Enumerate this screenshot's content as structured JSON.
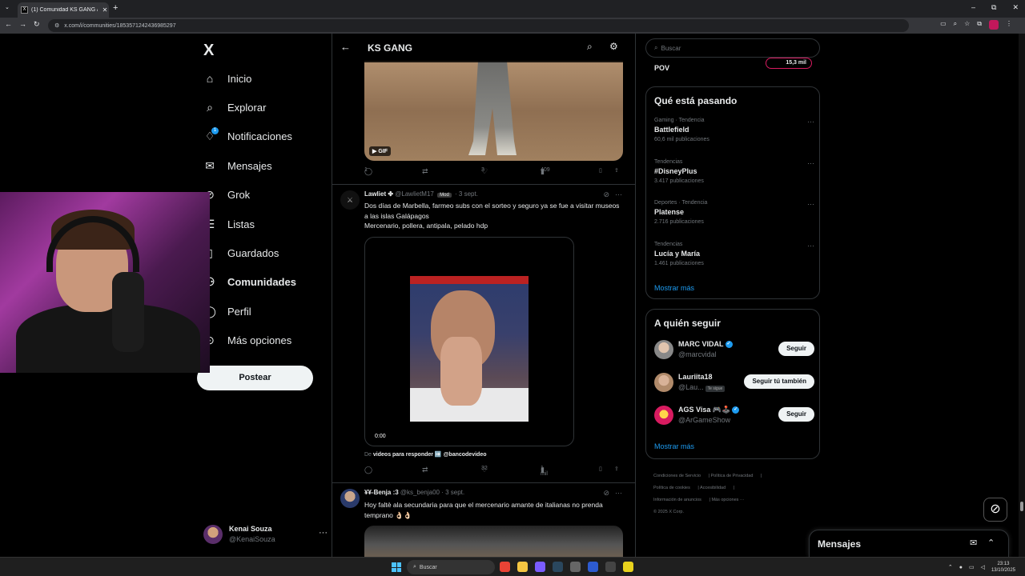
{
  "browser": {
    "tab_title": "(1) Comunidad KS GANG / X",
    "tab_favicon": "X",
    "url": "x.com/i/communities/1853571242436985297"
  },
  "nav": {
    "logo": "X",
    "items": [
      {
        "label": "Inicio",
        "icon": "home-icon",
        "glyph": "⌂"
      },
      {
        "label": "Explorar",
        "icon": "search-icon",
        "glyph": "⌕"
      },
      {
        "label": "Notificaciones",
        "icon": "bell-icon",
        "glyph": "♢",
        "badge": "1"
      },
      {
        "label": "Mensajes",
        "icon": "mail-icon",
        "glyph": "✉"
      },
      {
        "label": "Grok",
        "icon": "grok-icon",
        "glyph": "⊘"
      },
      {
        "label": "Listas",
        "icon": "list-icon",
        "glyph": "☰"
      },
      {
        "label": "Guardados",
        "icon": "bookmark-icon",
        "glyph": "▯"
      },
      {
        "label": "Comunidades",
        "icon": "communities-icon",
        "glyph": "⚇",
        "active": true
      },
      {
        "label": "Perfil",
        "icon": "profile-icon",
        "glyph": "◯"
      },
      {
        "label": "Más opciones",
        "icon": "more-circle-icon",
        "glyph": "⊙"
      }
    ],
    "post_button": "Postear",
    "account": {
      "name": "Kenai Souza",
      "handle": "@KenaiSouza",
      "more": "···"
    }
  },
  "header": {
    "title": "KS GANG",
    "back": "←"
  },
  "tweet0": {
    "gif_label": "GIF",
    "replies": "1",
    "retweets": "",
    "likes": "3",
    "views": "409"
  },
  "tweet1": {
    "name": "Lawliet ✤",
    "handle": "@LawlietM17",
    "role": "Mod",
    "time": "· 3 sept.",
    "text1": "Dos días de Marbella, farmeo subs con el sorteo y seguro ya se fue a visitar museos a las islas Galápagos",
    "text2": "Mercenario, pollera, antipala, pelado hdp",
    "video_time": "0:00",
    "source_prefix": "De",
    "source_bold": "videos para responder ➡️ @bancodevideo",
    "replies": "",
    "retweets": "",
    "likes": "32",
    "views": "1 mil"
  },
  "tweet2": {
    "name": "¥¥-Benja :3",
    "handle": "@ks_benja00",
    "time": "· 3 sept.",
    "text": "Hoy faltè ala secundaria para que el mercenario amante de italianas no prenda temprano 👌🏻👌🏻"
  },
  "right": {
    "search_placeholder": "Buscar",
    "pov_label": "POV",
    "pov_count": "15,3 mil",
    "trending_title": "Qué está pasando",
    "trends": [
      {
        "meta": "Gaming · Tendencia",
        "title": "Battlefield",
        "count": "60,6 mil publicaciones"
      },
      {
        "meta": "Tendencias",
        "title": "#DisneyPlus",
        "count": "3.417 publicaciones"
      },
      {
        "meta": "Deportes · Tendencia",
        "title": "Platense",
        "count": "2.716 publicaciones"
      },
      {
        "meta": "Tendencias",
        "title": "Lucía y María",
        "count": "1.461 publicaciones"
      }
    ],
    "show_more": "Mostrar más",
    "follow_title": "A quién seguir",
    "follows": [
      {
        "name": "MARC VIDAL",
        "handle": "@marcvidal",
        "button": "Seguir",
        "verified": true
      },
      {
        "name": "Lauriita18",
        "handle": "@Lau...",
        "button": "Seguir tú también",
        "tag": "Te sigue"
      },
      {
        "name": "AGS Visa 🎮🕹️",
        "handle": "@ArGameShow",
        "button": "Seguir",
        "verified": true
      }
    ],
    "footer": [
      "Condiciones de Servicio",
      "Política de Privacidad",
      "Política de cookies",
      "Accesibilidad",
      "Información de anuncios",
      "Más opciones ···",
      "© 2025 X Corp."
    ]
  },
  "messages": {
    "title": "Mensajes"
  },
  "taskbar": {
    "search": "Buscar",
    "time": "23:13",
    "date": "13/10/2025"
  }
}
